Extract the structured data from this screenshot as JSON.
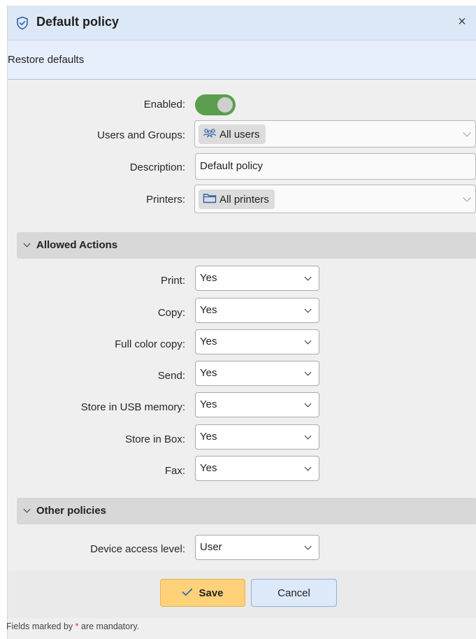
{
  "dialog": {
    "title": "Default policy",
    "close_label": "×"
  },
  "toolbar": {
    "restore_label": "Restore defaults"
  },
  "general": {
    "enabled_label": "Enabled:",
    "enabled_value": true,
    "users_label": "Users and Groups:",
    "users_value": "All users",
    "description_label": "Description:",
    "description_value": "Default policy",
    "printers_label": "Printers:",
    "printers_value": "All printers"
  },
  "sections": {
    "allowed_actions_title": "Allowed Actions",
    "other_policies_title": "Other policies"
  },
  "allowed_actions": [
    {
      "label": "Print:",
      "value": "Yes"
    },
    {
      "label": "Copy:",
      "value": "Yes"
    },
    {
      "label": "Full color copy:",
      "value": "Yes"
    },
    {
      "label": "Send:",
      "value": "Yes"
    },
    {
      "label": "Store in USB memory:",
      "value": "Yes"
    },
    {
      "label": "Store in Box:",
      "value": "Yes"
    },
    {
      "label": "Fax:",
      "value": "Yes"
    }
  ],
  "other_policies": {
    "device_access_label": "Device access level:",
    "device_access_value": "User"
  },
  "buttons": {
    "save_label": "Save",
    "cancel_label": "Cancel"
  },
  "footer": {
    "note_prefix": "Fields marked by ",
    "note_star": "*",
    "note_suffix": " are mandatory."
  },
  "colors": {
    "titlebar_bg": "#dde8f7",
    "toggle_on": "#5a9e4e",
    "save_bg": "#ffd27a",
    "cancel_bg": "#dde9f8",
    "section_bg": "#d8d8d8"
  }
}
